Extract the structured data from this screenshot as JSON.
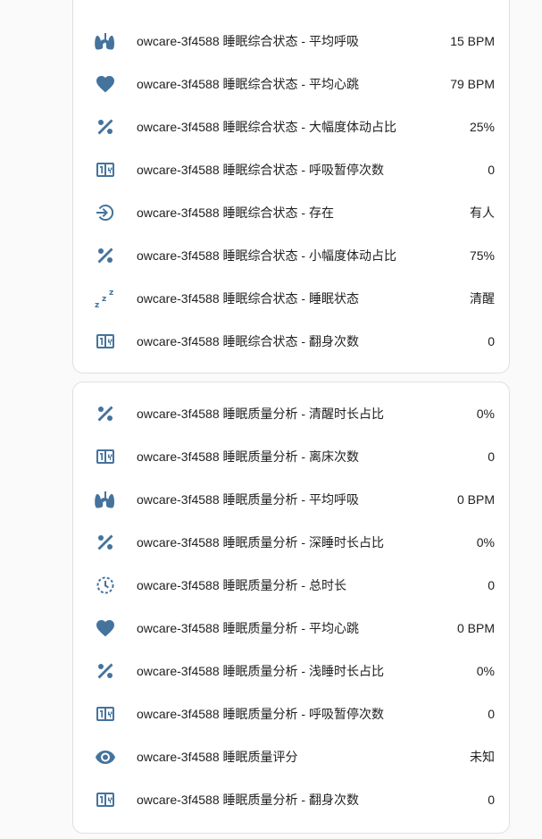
{
  "colors": {
    "icon": "#44739e",
    "text": "#212121",
    "card_border": "#e0e0e0",
    "background": "#fafafa"
  },
  "cards": [
    {
      "rows": [
        {
          "icon": "lungs-icon",
          "name": "owcare-3f4588 睡眠综合状态 - 平均呼吸",
          "value": "15 BPM"
        },
        {
          "icon": "heart-icon",
          "name": "owcare-3f4588 睡眠综合状态 - 平均心跳",
          "value": "79 BPM"
        },
        {
          "icon": "percent-icon",
          "name": "owcare-3f4588 睡眠综合状态 - 大幅度体动占比",
          "value": "25%"
        },
        {
          "icon": "counter-icon",
          "name": "owcare-3f4588 睡眠综合状态 - 呼吸暂停次数",
          "value": "0"
        },
        {
          "icon": "login-icon",
          "name": "owcare-3f4588 睡眠综合状态 - 存在",
          "value": "有人"
        },
        {
          "icon": "percent-icon",
          "name": "owcare-3f4588 睡眠综合状态 - 小幅度体动占比",
          "value": "75%"
        },
        {
          "icon": "sleep-icon",
          "name": "owcare-3f4588 睡眠综合状态 - 睡眠状态",
          "value": "清醒"
        },
        {
          "icon": "counter-icon",
          "name": "owcare-3f4588 睡眠综合状态 - 翻身次数",
          "value": "0"
        }
      ]
    },
    {
      "rows": [
        {
          "icon": "percent-icon",
          "name": "owcare-3f4588 睡眠质量分析 - 清醒时长占比",
          "value": "0%"
        },
        {
          "icon": "counter-icon",
          "name": "owcare-3f4588 睡眠质量分析 - 离床次数",
          "value": "0"
        },
        {
          "icon": "lungs-icon",
          "name": "owcare-3f4588 睡眠质量分析 - 平均呼吸",
          "value": "0 BPM"
        },
        {
          "icon": "percent-icon",
          "name": "owcare-3f4588 睡眠质量分析 - 深睡时长占比",
          "value": "0%"
        },
        {
          "icon": "history-icon",
          "name": "owcare-3f4588 睡眠质量分析 - 总时长",
          "value": "0"
        },
        {
          "icon": "heart-icon",
          "name": "owcare-3f4588 睡眠质量分析 - 平均心跳",
          "value": "0 BPM"
        },
        {
          "icon": "percent-icon",
          "name": "owcare-3f4588 睡眠质量分析 - 浅睡时长占比",
          "value": "0%"
        },
        {
          "icon": "counter-icon",
          "name": "owcare-3f4588 睡眠质量分析 - 呼吸暂停次数",
          "value": "0"
        },
        {
          "icon": "eye-icon",
          "name": "owcare-3f4588 睡眠质量评分",
          "value": "未知"
        },
        {
          "icon": "counter-icon",
          "name": "owcare-3f4588 睡眠质量分析 - 翻身次数",
          "value": "0"
        }
      ]
    }
  ]
}
